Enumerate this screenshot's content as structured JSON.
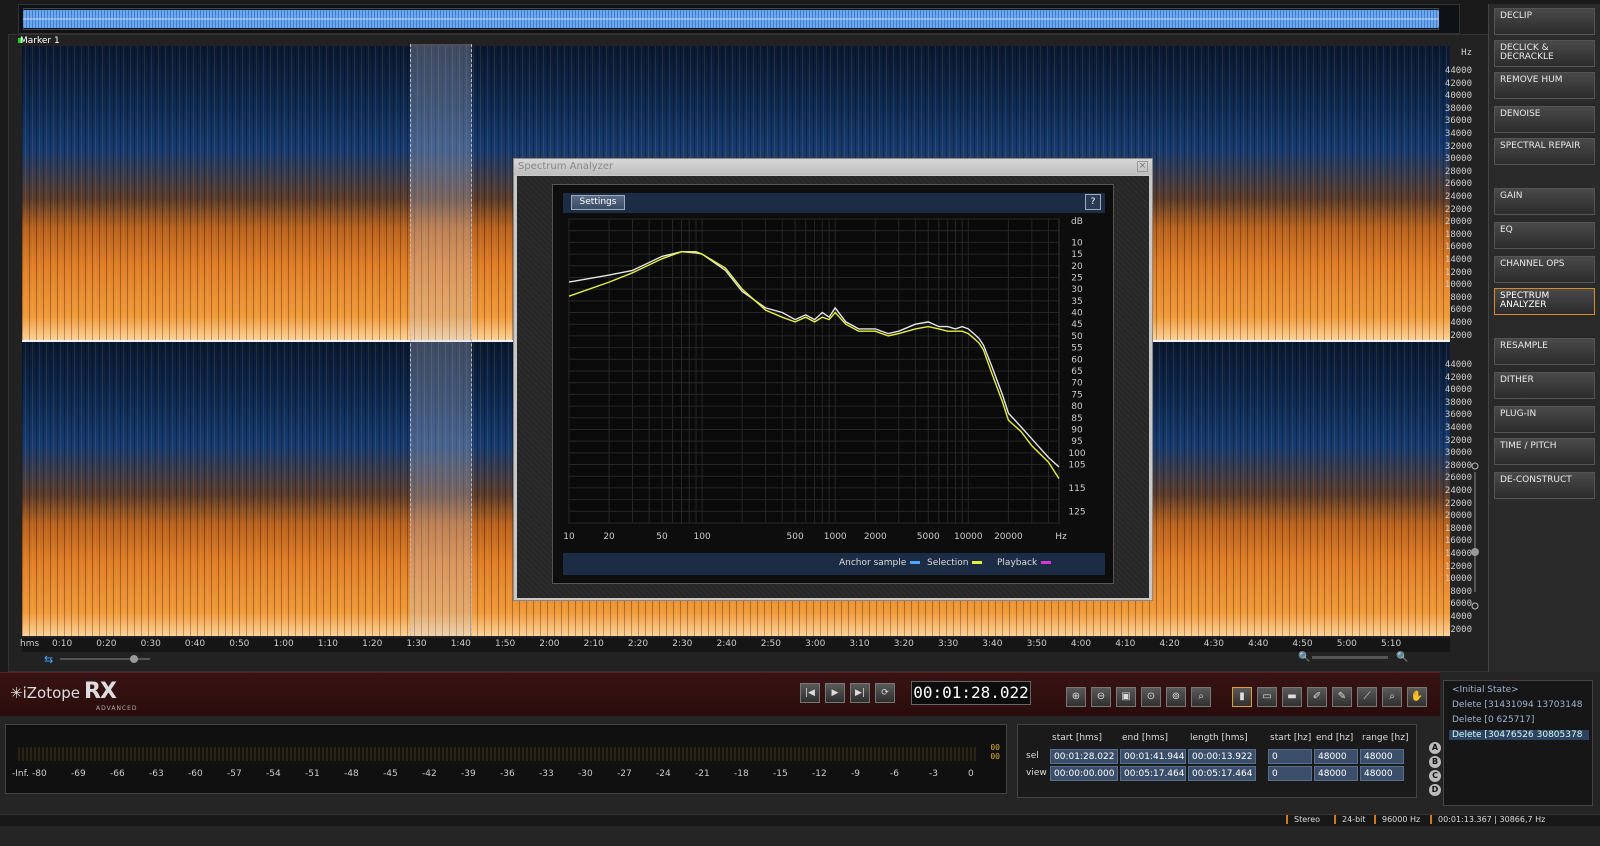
{
  "overview": {},
  "marker": {
    "label": "Marker 1"
  },
  "hz_unit": "Hz",
  "hz_labels": [
    "44000",
    "42000",
    "40000",
    "38000",
    "36000",
    "34000",
    "32000",
    "30000",
    "28000",
    "26000",
    "24000",
    "22000",
    "20000",
    "18000",
    "16000",
    "14000",
    "12000",
    "10000",
    "8000",
    "6000",
    "4000",
    "2000"
  ],
  "time_ruler": {
    "unit": "hms",
    "ticks": [
      "0:10",
      "0:20",
      "0:30",
      "0:40",
      "0:50",
      "1:00",
      "1:10",
      "1:20",
      "1:30",
      "1:40",
      "1:50",
      "2:00",
      "2:10",
      "2:20",
      "2:30",
      "2:40",
      "2:50",
      "3:00",
      "3:10",
      "3:20",
      "3:30",
      "3:40",
      "3:50",
      "4:00",
      "4:10",
      "4:20",
      "4:30",
      "4:40",
      "4:50",
      "5:00",
      "5:10"
    ]
  },
  "modules": [
    {
      "label": "Declip"
    },
    {
      "label": "Declick & Decrackle"
    },
    {
      "label": "Remove Hum"
    },
    {
      "label": "Denoise"
    },
    {
      "label": "Spectral Repair"
    },
    {
      "label": "Gain"
    },
    {
      "label": "EQ"
    },
    {
      "label": "Channel Ops"
    },
    {
      "label": "Spectrum Analyzer",
      "active": true
    },
    {
      "label": "Resample"
    },
    {
      "label": "Dither"
    },
    {
      "label": "Plug-In"
    },
    {
      "label": "Time / Pitch"
    },
    {
      "label": "De-construct"
    }
  ],
  "spectrum_analyzer": {
    "title": "Spectrum Analyzer",
    "close": "×",
    "settings_label": "Settings",
    "help_label": "?",
    "db_unit": "dB",
    "hz_unit": "Hz",
    "legend": {
      "anchor": "Anchor sample",
      "selection": "Selection",
      "playback": "Playback"
    },
    "colors": {
      "anchor": "#4aa8ff",
      "selection": "#e6f03a",
      "playback": "#d23ad2",
      "white": "#e6e6e6"
    }
  },
  "chart_data": {
    "type": "line",
    "x_scale": "log",
    "xlim": [
      10,
      48000
    ],
    "ylim": [
      0,
      130
    ],
    "y_inverted": true,
    "xticks": [
      {
        "v": 10,
        "label": "10"
      },
      {
        "v": 20,
        "label": "20"
      },
      {
        "v": 50,
        "label": "50"
      },
      {
        "v": 100,
        "label": "100"
      },
      {
        "v": 500,
        "label": "500"
      },
      {
        "v": 1000,
        "label": "1000"
      },
      {
        "v": 2000,
        "label": "2000"
      },
      {
        "v": 5000,
        "label": "5000"
      },
      {
        "v": 10000,
        "label": "10000"
      },
      {
        "v": 20000,
        "label": "20000"
      }
    ],
    "yticks": [
      10,
      15,
      20,
      25,
      30,
      35,
      40,
      45,
      50,
      55,
      60,
      65,
      70,
      75,
      80,
      85,
      90,
      95,
      100,
      105,
      115,
      125
    ],
    "grid": true,
    "series": [
      {
        "color": "#e6e6e6",
        "x": [
          10,
          20,
          30,
          50,
          70,
          90,
          100,
          150,
          200,
          300,
          400,
          500,
          600,
          700,
          800,
          900,
          1000,
          1200,
          1500,
          2000,
          2500,
          3000,
          4000,
          5000,
          6000,
          7000,
          8000,
          9000,
          10000,
          11000,
          12000,
          13000,
          15000,
          18000,
          20000,
          25000,
          30000,
          40000,
          48000
        ],
        "y": [
          27,
          24,
          22,
          16,
          14,
          14.5,
          15,
          22,
          31,
          38,
          40,
          43,
          41,
          43,
          40,
          42,
          38,
          44,
          47,
          47,
          49,
          48,
          45,
          44,
          46,
          46,
          47,
          46,
          47,
          49,
          51,
          54,
          63,
          75,
          83,
          89,
          94,
          102,
          106
        ]
      },
      {
        "color": "#e6f03a",
        "x": [
          10,
          20,
          30,
          50,
          70,
          90,
          100,
          150,
          200,
          300,
          400,
          500,
          600,
          700,
          800,
          900,
          1000,
          1200,
          1500,
          2000,
          2500,
          3000,
          4000,
          5000,
          6000,
          7000,
          8000,
          9000,
          10000,
          11000,
          12000,
          13000,
          15000,
          18000,
          20000,
          25000,
          30000,
          40000,
          48000
        ],
        "y": [
          33,
          27,
          23,
          17,
          14,
          14,
          15,
          21,
          30,
          39,
          42,
          44,
          42,
          44,
          42,
          43,
          40,
          45,
          48,
          48,
          50,
          49,
          47,
          46,
          47,
          48,
          48,
          48,
          49,
          51,
          53,
          56,
          66,
          78,
          86,
          91,
          97,
          104,
          111
        ]
      }
    ]
  },
  "transport": {
    "time": "00:01:28.022"
  },
  "meter": {
    "peak_l": "00",
    "peak_r": "00",
    "scale": [
      "-Inf.",
      "-80",
      "-69",
      "-66",
      "-63",
      "-60",
      "-57",
      "-54",
      "-51",
      "-48",
      "-45",
      "-42",
      "-39",
      "-36",
      "-33",
      "-30",
      "-27",
      "-24",
      "-21",
      "-18",
      "-15",
      "-12",
      "-9",
      "-6",
      "-3",
      "0"
    ]
  },
  "selection_info": {
    "headers": {
      "start_hms": "start [hms]",
      "end_hms": "end [hms]",
      "length_hms": "length [hms]",
      "start_hz": "start [hz]",
      "end_hz": "end [hz]",
      "range_hz": "range [hz]"
    },
    "sel": {
      "label": "sel",
      "start": "00:01:28.022",
      "end": "00:01:41.944",
      "length": "00:00:13.922",
      "start_hz": "0",
      "end_hz": "48000",
      "range_hz": "48000"
    },
    "view": {
      "label": "view",
      "start": "00:00:00.000",
      "end": "00:05:17.464",
      "length": "00:05:17.464",
      "start_hz": "0",
      "end_hz": "48000",
      "range_hz": "48000"
    }
  },
  "history": [
    {
      "label": "<Initial State>"
    },
    {
      "label": "Delete [31431094 13703148"
    },
    {
      "label": "Delete [0 625717]"
    },
    {
      "label": "Delete [30476526 30805378",
      "selected": true
    }
  ],
  "history_tabs": [
    "A",
    "B",
    "C",
    "D"
  ],
  "status": {
    "channels": "Stereo",
    "bits": "24-bit",
    "rate": "96000 Hz",
    "cursor": "00:01:13.367 | 30866,7 Hz"
  },
  "brand": {
    "name": "iZotope",
    "product": "RX",
    "edition": "ADVANCED"
  }
}
